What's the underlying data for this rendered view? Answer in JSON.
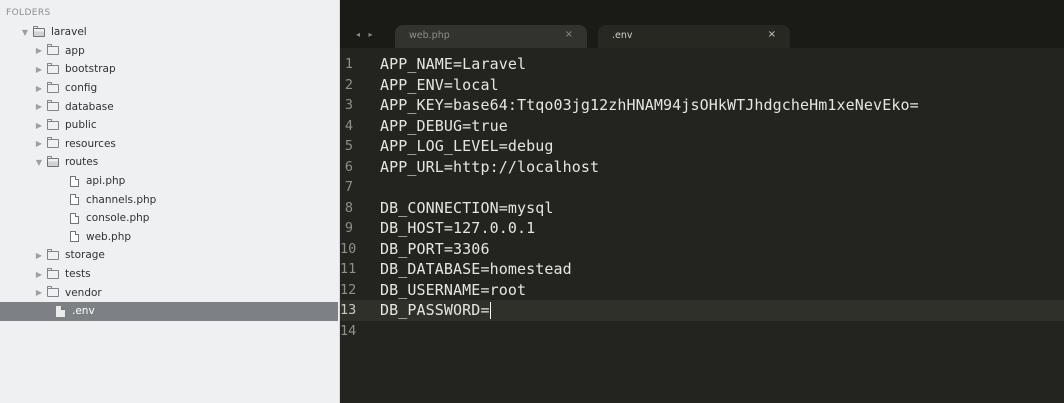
{
  "sidebar": {
    "title": "FOLDERS",
    "items": [
      {
        "label": "laravel",
        "type": "folder",
        "expanded": true,
        "depth": 0
      },
      {
        "label": "app",
        "type": "folder",
        "expanded": false,
        "depth": 1
      },
      {
        "label": "bootstrap",
        "type": "folder",
        "expanded": false,
        "depth": 1
      },
      {
        "label": "config",
        "type": "folder",
        "expanded": false,
        "depth": 1
      },
      {
        "label": "database",
        "type": "folder",
        "expanded": false,
        "depth": 1
      },
      {
        "label": "public",
        "type": "folder",
        "expanded": false,
        "depth": 1
      },
      {
        "label": "resources",
        "type": "folder",
        "expanded": false,
        "depth": 1
      },
      {
        "label": "routes",
        "type": "folder",
        "expanded": true,
        "depth": 1
      },
      {
        "label": "api.php",
        "type": "file",
        "depth": 2
      },
      {
        "label": "channels.php",
        "type": "file",
        "depth": 2
      },
      {
        "label": "console.php",
        "type": "file",
        "depth": 2
      },
      {
        "label": "web.php",
        "type": "file",
        "depth": 2
      },
      {
        "label": "storage",
        "type": "folder",
        "expanded": false,
        "depth": 1
      },
      {
        "label": "tests",
        "type": "folder",
        "expanded": false,
        "depth": 1
      },
      {
        "label": "vendor",
        "type": "folder",
        "expanded": false,
        "depth": 1
      },
      {
        "label": ".env",
        "type": "file",
        "depth": 1,
        "selected": true
      }
    ]
  },
  "editor": {
    "nav_arrows": "◂ ▸",
    "tabs": [
      {
        "label": "web.php",
        "close": "×",
        "active": false
      },
      {
        "label": ".env",
        "close": "×",
        "active": true
      }
    ],
    "current_line": 13,
    "lines": [
      "APP_NAME=Laravel",
      "APP_ENV=local",
      "APP_KEY=base64:Ttqo03jg12zhHNAM94jsOHkWTJhdgcheHm1xeNevEko=",
      "APP_DEBUG=true",
      "APP_LOG_LEVEL=debug",
      "APP_URL=http://localhost",
      "",
      "DB_CONNECTION=mysql",
      "DB_HOST=127.0.0.1",
      "DB_PORT=3306",
      "DB_DATABASE=homestead",
      "DB_USERNAME=root",
      "DB_PASSWORD=",
      ""
    ]
  },
  "colors": {
    "sidebar_bg": "#eef0f1",
    "editor_bg": "#23241f",
    "selected_row": "#7d8185",
    "code_text": "#e6e6e0"
  }
}
